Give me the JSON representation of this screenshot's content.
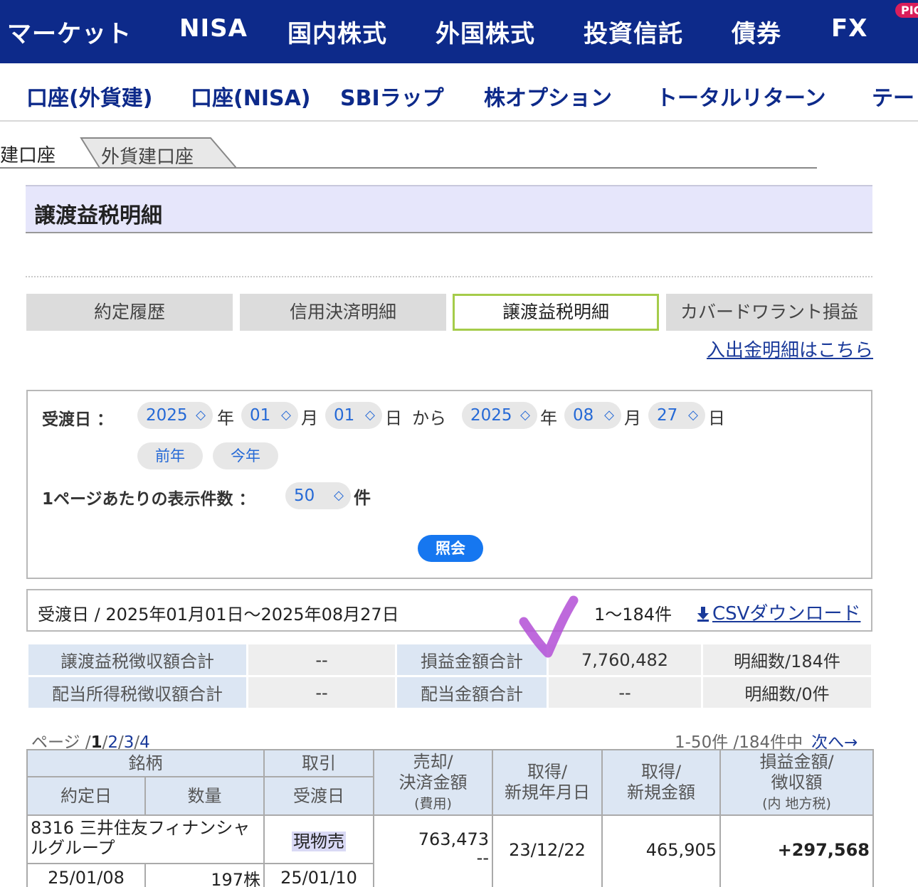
{
  "top_nav": {
    "items": [
      "マーケット",
      "NISA",
      "国内株式",
      "外国株式",
      "投資信託",
      "債券",
      "FX"
    ],
    "badge": "PIC"
  },
  "sub_nav": {
    "items": [
      "口座(外貨建)",
      "口座(NISA)",
      "SBIラップ",
      "株オプション",
      "トータルリターン",
      "テー"
    ]
  },
  "account_tabs": {
    "active": "建口座",
    "inactive": "外貨建口座"
  },
  "page_title": "譲渡益税明細",
  "section_tabs": [
    {
      "label": "約定履歴",
      "active": false
    },
    {
      "label": "信用決済明細",
      "active": false
    },
    {
      "label": "譲渡益税明細",
      "active": true
    },
    {
      "label": "カバードワラント損益",
      "active": false
    }
  ],
  "cash_link": "入出金明細はこちら",
  "search": {
    "date_label": "受渡日 ：",
    "from": {
      "year": "2025",
      "month": "01",
      "day": "01"
    },
    "to": {
      "year": "2025",
      "month": "08",
      "day": "27"
    },
    "unit_year": "年",
    "unit_month": "月",
    "unit_day": "日",
    "from_word": "から",
    "prev_year_button": "前年",
    "this_year_button": "今年",
    "per_page_label": "1ページあたりの表示件数 ：",
    "per_page_value": "50",
    "per_page_unit": "件",
    "submit_button": "照会"
  },
  "summary": {
    "range": "受渡日 / 2025年01月01日～2025年08月27日",
    "count": "1～184件",
    "csv_link": "CSVダウンロード"
  },
  "totals": {
    "row1": {
      "h1": "譲渡益税徴収額合計",
      "v1": "--",
      "h2": "損益金額合計",
      "v2": "7,760,482",
      "v3": "明細数/184件"
    },
    "row2": {
      "h1": "配当所得税徴収額合計",
      "v1": "--",
      "h2": "配当金額合計",
      "v2": "--",
      "v3": "明細数/0件"
    }
  },
  "pager": {
    "prefix": "ページ /",
    "current": "1",
    "pages": [
      "2",
      "3",
      "4"
    ],
    "range": "1-50件 /184件中",
    "next": "次へ→"
  },
  "detail": {
    "headers": {
      "stock": "銘柄",
      "trade": "取引",
      "sale": [
        "売却/",
        "決済金額",
        "(費用)"
      ],
      "acq_date": [
        "取得/",
        "新規年月日"
      ],
      "acq_amount": [
        "取得/",
        "新規金額"
      ],
      "profit": [
        "損益金額/",
        "徴収額",
        "(内 地方税)"
      ],
      "contract_date": "約定日",
      "quantity": "数量",
      "settle_date": "受渡日"
    },
    "rows": [
      {
        "name": "8316 三井住友フィナンシャルグループ",
        "trade": "現物売",
        "sale_amount": "763,473",
        "cost": "--",
        "acq_date": "23/12/22",
        "acq_amount": "465,905",
        "profit": "+297,568",
        "contract_date": "25/01/08",
        "quantity": "197株",
        "settle_date": "25/01/10"
      }
    ]
  },
  "colors": {
    "nav_bg": "#0d2a8a",
    "link": "#1a3a9a",
    "profit": "#e02020",
    "active_tab_border": "#a5cc4a",
    "submit": "#1677f0",
    "checkmark": "#b34fd6"
  }
}
